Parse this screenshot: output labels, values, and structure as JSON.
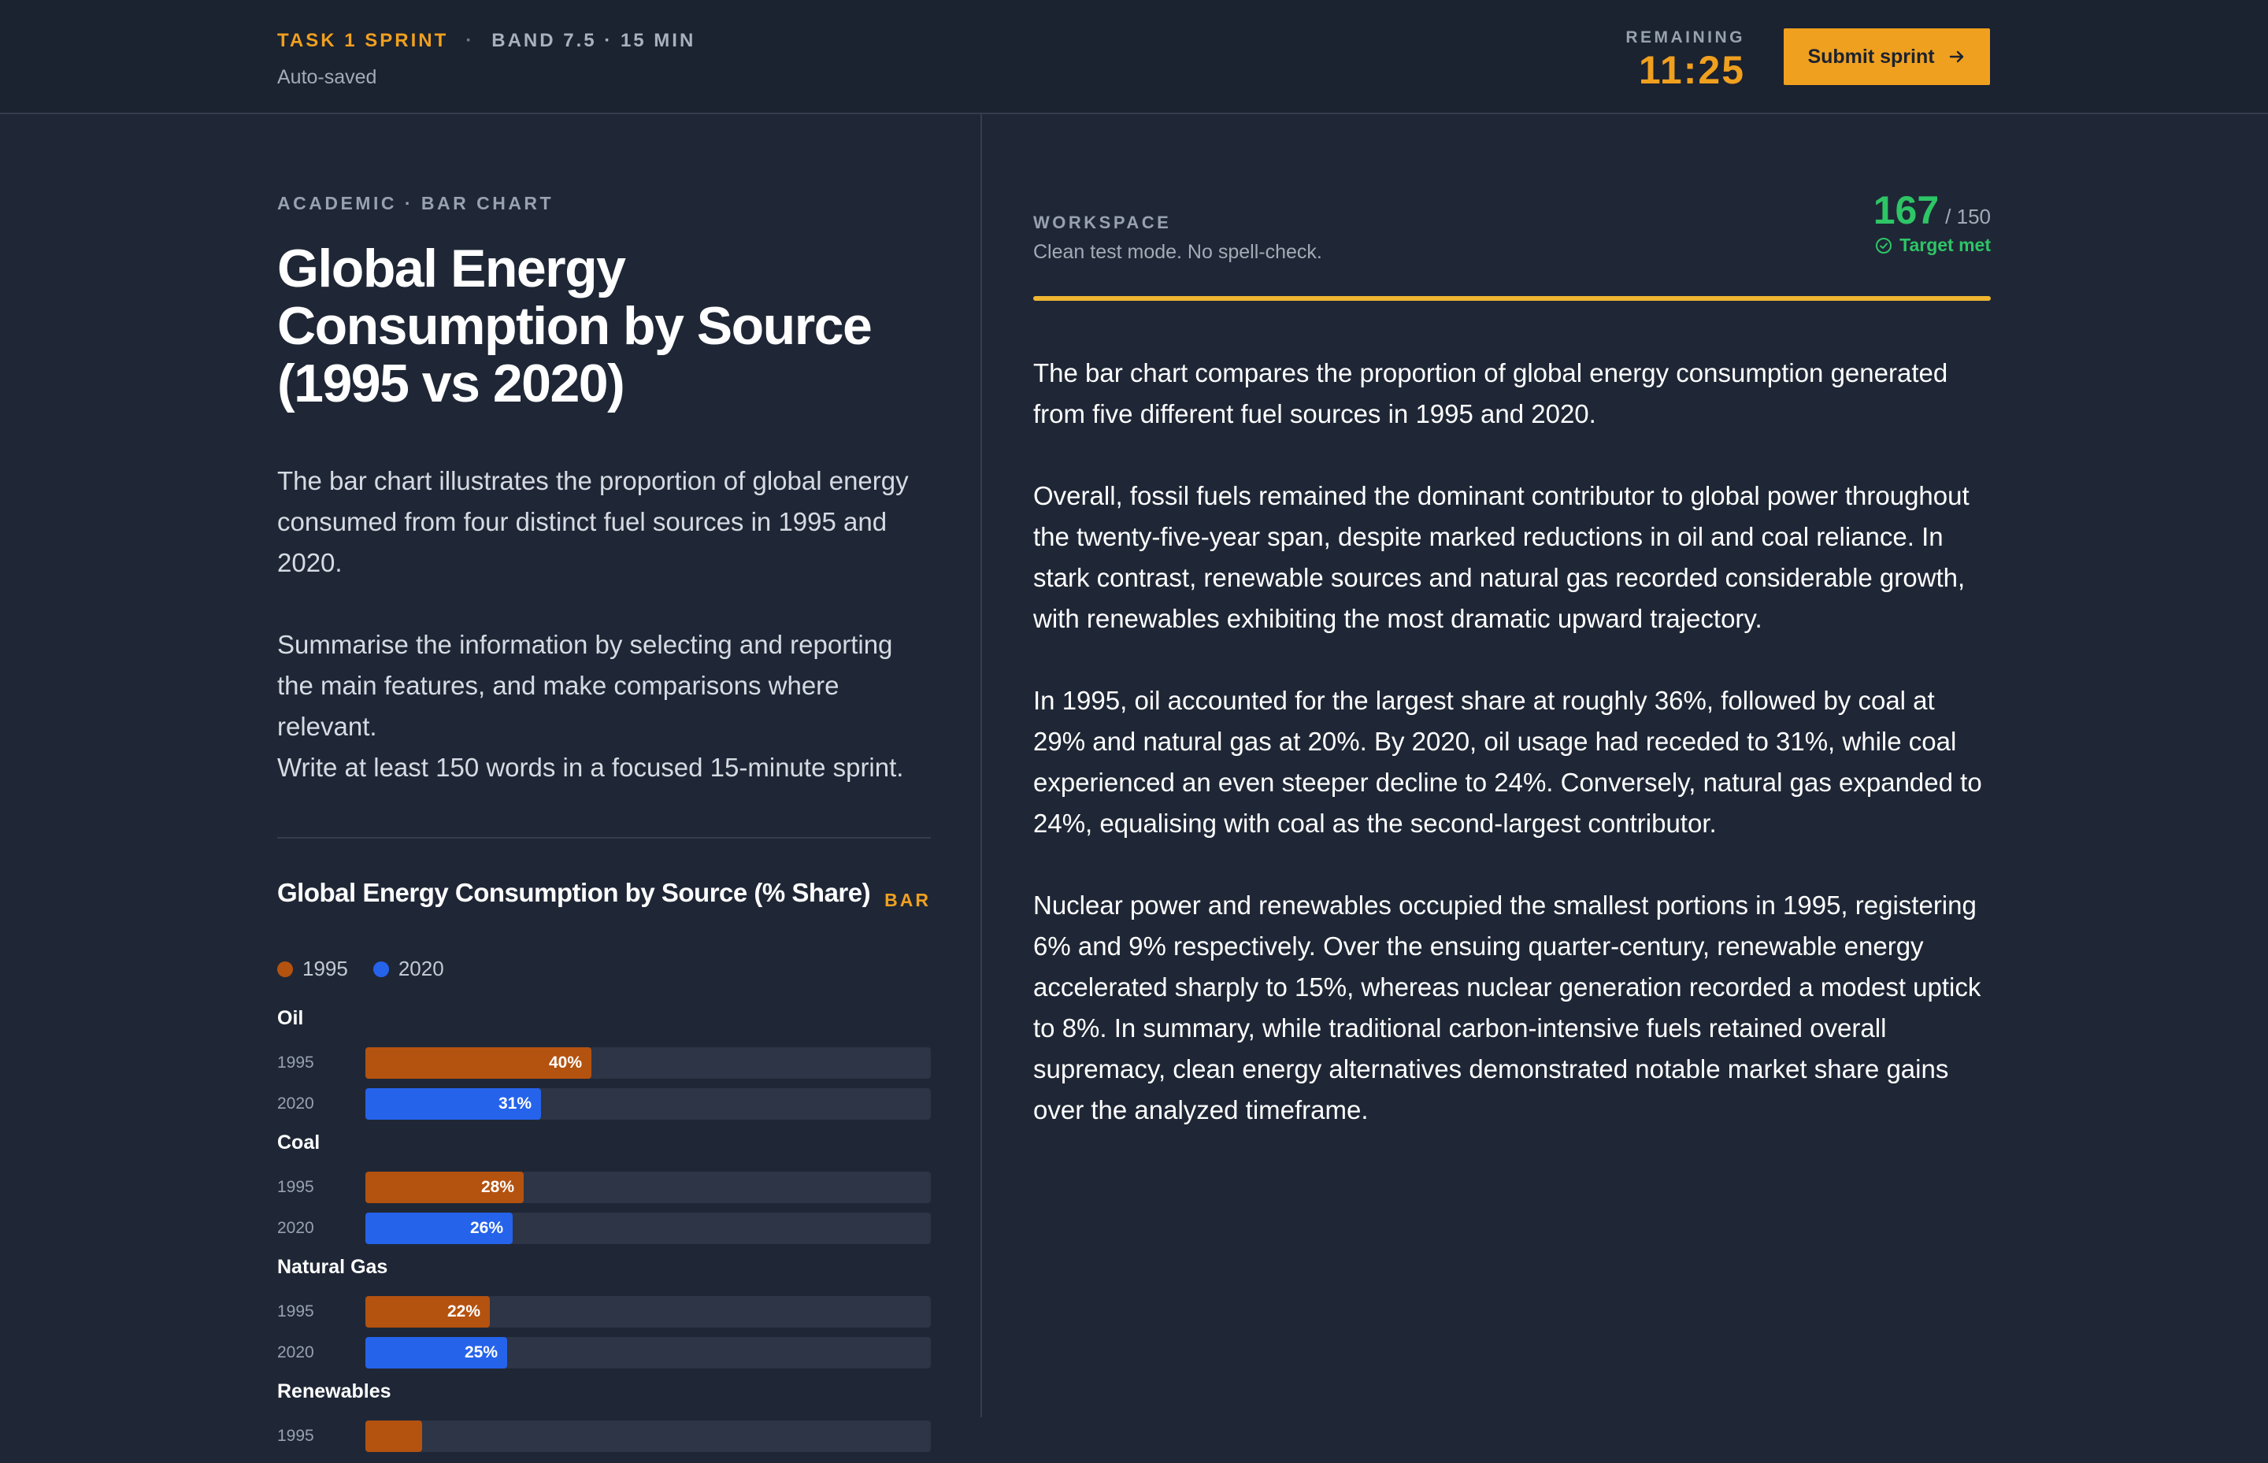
{
  "header": {
    "sprint_label": "TASK 1 SPRINT",
    "separator": "·",
    "band_label": "BAND 7.5 · 15 MIN",
    "autosave": "Auto-saved",
    "remaining_label": "REMAINING",
    "remaining_time": "11:25",
    "submit_label": "Submit sprint"
  },
  "task": {
    "type": "ACADEMIC · BAR CHART",
    "title": "Global Energy Consumption by Source (1995 vs 2020)",
    "prompt_p1": "The bar chart illustrates the proportion of global energy consumed from four distinct fuel sources in 1995 and 2020.",
    "prompt_p2": "Summarise the information by selecting and reporting the main features, and make comparisons where relevant.",
    "prompt_p3": "Write at least 150 words in a focused 15-minute sprint."
  },
  "chart_data": {
    "type": "bar",
    "title": "Global Energy Consumption by Source (% Share)",
    "badge": "BAR",
    "orientation": "horizontal",
    "xlim": [
      0,
      100
    ],
    "legend": [
      "1995",
      "2020"
    ],
    "colors": {
      "1995": "#b4520f",
      "2020": "#2563eb"
    },
    "categories": [
      "Oil",
      "Coal",
      "Natural Gas",
      "Renewables"
    ],
    "series": [
      {
        "name": "1995",
        "values": [
          40,
          28,
          22,
          10
        ]
      },
      {
        "name": "2020",
        "values": [
          31,
          26,
          25,
          null
        ]
      }
    ],
    "value_labels": {
      "1995": [
        "40%",
        "28%",
        "22%",
        ""
      ],
      "2020": [
        "31%",
        "26%",
        "25%",
        ""
      ]
    }
  },
  "workspace": {
    "label": "WORKSPACE",
    "sub": "Clean test mode. No spell-check.",
    "word_count": "167",
    "word_target": "/ 150",
    "status": "Target met",
    "progress": 1.0,
    "essay": [
      "The bar chart compares the proportion of global energy consumption generated from five different fuel sources in 1995 and 2020.",
      "Overall, fossil fuels remained the dominant contributor to global power throughout the twenty-five-year span, despite marked reductions in oil and coal reliance. In stark contrast, renewable sources and natural gas recorded considerable growth, with renewables exhibiting the most dramatic upward trajectory.",
      "In 1995, oil accounted for the largest share at roughly 36%, followed by coal at 29% and natural gas at 20%. By 2020, oil usage had receded to 31%, while coal experienced an even steeper decline to 24%. Conversely, natural gas expanded to 24%, equalising with coal as the second-largest contributor.",
      "Nuclear power and renewables occupied the smallest portions in 1995, registering 6% and 9% respectively. Over the ensuing quarter-century, renewable energy accelerated sharply to 15%, whereas nuclear generation recorded a modest uptick to 8%. In summary, while traditional carbon-intensive fuels retained overall supremacy, clean energy alternatives demonstrated notable market share gains over the analyzed timeframe."
    ]
  }
}
